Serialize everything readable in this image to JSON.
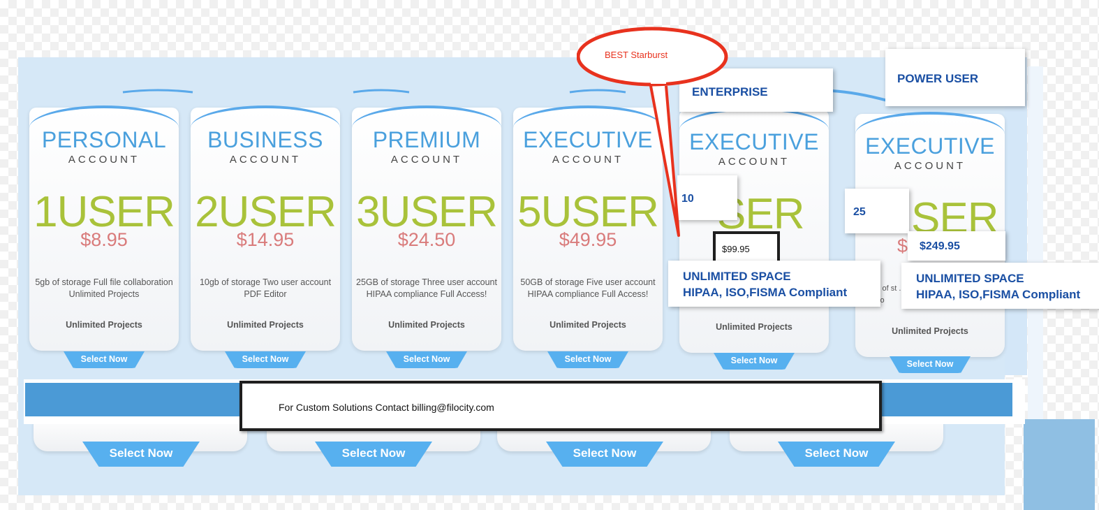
{
  "cards": [
    {
      "title": "PERSONAL",
      "subtitle": "ACCOUNT",
      "users": "1USER",
      "price": "$8.95",
      "features": "5gb of storage Full file collaboration Unlimited Projects",
      "unlimited": "Unlimited Projects",
      "cta": "Select Now"
    },
    {
      "title": "BUSINESS",
      "subtitle": "ACCOUNT",
      "users": "2USER",
      "price": "$14.95",
      "features": "10gb of storage Two user account PDF Editor",
      "unlimited": "Unlimited Projects",
      "cta": "Select Now"
    },
    {
      "title": "PREMIUM",
      "subtitle": "ACCOUNT",
      "users": "3USER",
      "price": "$24.50",
      "features": "25GB of storage Three user account HIPAA compliance Full Access!",
      "unlimited": "Unlimited Projects",
      "cta": "Select Now"
    },
    {
      "title": "EXECUTIVE",
      "subtitle": "ACCOUNT",
      "users": "5USER",
      "price": "$49.95",
      "features": "50GB of storage Five user account HIPAA compliance Full Access!",
      "unlimited": "Unlimited Projects",
      "cta": "Select Now"
    },
    {
      "title": "EXECUTIVE",
      "subtitle": "ACCOUNT",
      "users": "SER",
      "price": "5",
      "features": "",
      "unlimited": "Unlimited Projects",
      "cta": "Select Now"
    },
    {
      "title": "EXECUTIVE",
      "subtitle": "ACCOUNT",
      "users": "SER",
      "price": "$",
      "features": "s of st ... AA co",
      "unlimited": "Unlimited Projects",
      "cta": "Select Now"
    }
  ],
  "bottom_buttons": [
    "Select Now",
    "Select Now",
    "Select Now",
    "Select Now"
  ],
  "contact": "For Custom Solutions Contact billing@filocity.com",
  "annotations": {
    "starburst": "BEST Starburst",
    "enterprise": "ENTERPRISE",
    "power_user": "POWER USER",
    "users_10": "10",
    "users_25": "25",
    "price_99": "$99.95",
    "price_249": "$249.95",
    "unlimited_line1": "UNLIMITED SPACE",
    "unlimited_line2": "HIPAA, ISO,FISMA Compliant"
  },
  "colors": {
    "accent": "#4aa0dd",
    "users_green": "#a9c23a",
    "price_red": "#d97b7b",
    "note_blue": "#1a4fa3",
    "starburst_red": "#e8321e"
  }
}
